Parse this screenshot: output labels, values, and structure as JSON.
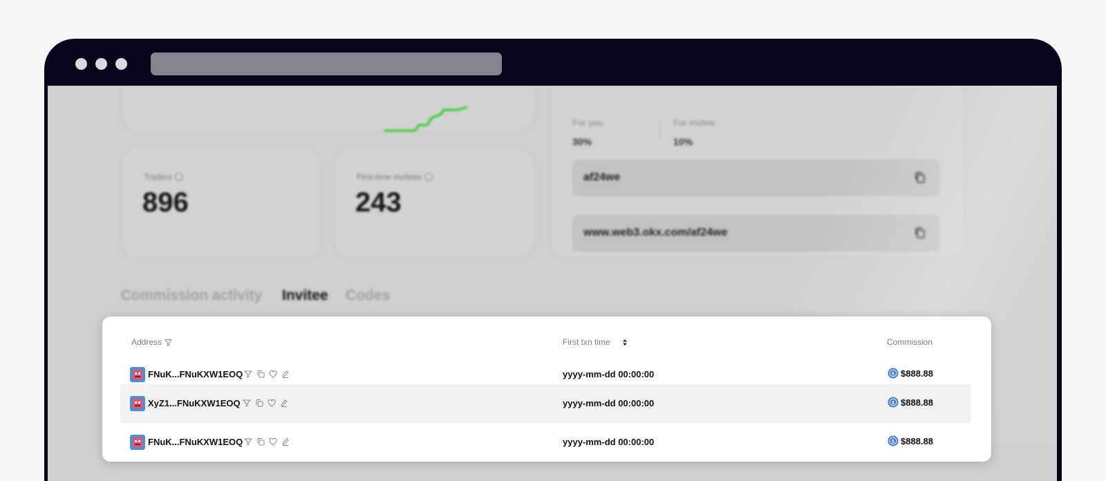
{
  "overview": {
    "traders": {
      "label": "Traders",
      "value": "896"
    },
    "first_time_invitees": {
      "label": "First-time invitees",
      "value": "243"
    }
  },
  "commission_share": {
    "for_you_label": "For you",
    "for_you_value": "30%",
    "for_invitee_label": "For invitee",
    "for_invitee_value": "10%",
    "code": "af24we",
    "link": "www.web3.okx.com/af24we"
  },
  "tabs": [
    {
      "label": "Commission activity",
      "active": false
    },
    {
      "label": "Invitee",
      "active": true
    },
    {
      "label": "Codes",
      "active": false
    }
  ],
  "table": {
    "columns": {
      "address": "Address",
      "first_txn_time": "First txn time",
      "commission": "Commission"
    },
    "rows": [
      {
        "address": "FNuK...FNuKXW1EOQ",
        "first_txn_time": "yyyy-mm-dd 00:00:00",
        "commission": "$888.88"
      },
      {
        "address": "XyZ1...FNuKXW1EOQ",
        "first_txn_time": "yyyy-mm-dd 00:00:00",
        "commission": "$888.88"
      },
      {
        "address": "FNuK...FNuKXW1EOQ",
        "first_txn_time": "yyyy-mm-dd 00:00:00",
        "commission": "$888.88"
      }
    ]
  },
  "colors": {
    "window_bar": "#07051a",
    "sparkline": "#2ecc1f",
    "avatar": "#4c8fd8",
    "coin": "#3a78e0"
  }
}
